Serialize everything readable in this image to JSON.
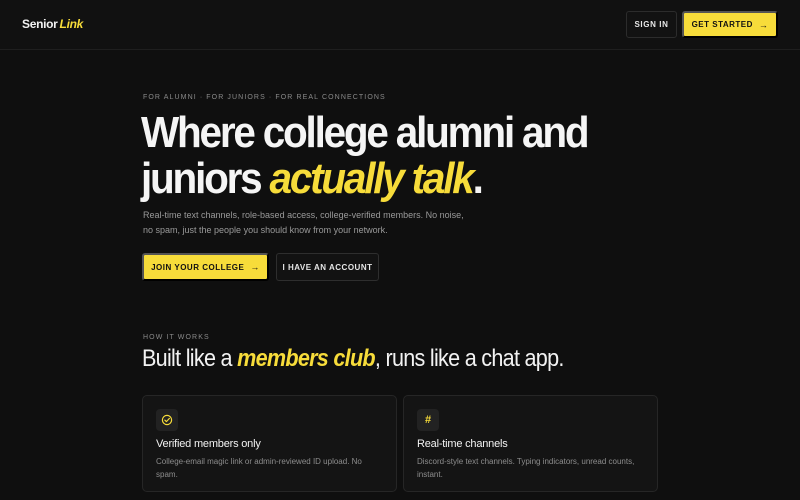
{
  "brand": {
    "name": "Senior",
    "accent": "Link"
  },
  "nav": {
    "sign_in": "SIGN IN",
    "get_started": "GET STARTED",
    "get_started_arrow": "→"
  },
  "hero": {
    "eyebrow": "FOR ALUMNI · FOR JUNIORS · FOR REAL CONNECTIONS",
    "title_line1": "Where college alumni and",
    "title_line2_prefix": "juniors ",
    "title_highlight": "actually talk",
    "title_suffix": ".",
    "subtitle": "Real-time text channels, role-based access, college-verified members. No noise, no spam, just the people you should know from your network.",
    "primary_cta": "JOIN YOUR COLLEGE",
    "primary_cta_arrow": "→",
    "secondary_cta": "I HAVE AN ACCOUNT"
  },
  "how": {
    "eyebrow": "HOW IT WORKS",
    "title_prefix": "Built like a ",
    "title_highlight": "members club",
    "title_suffix": ", runs like a chat app."
  },
  "cards": [
    {
      "icon": "check-circle-icon",
      "glyph": "✓",
      "title": "Verified members only",
      "desc": "College-email magic link or admin-reviewed ID upload. No spam."
    },
    {
      "icon": "hash-icon",
      "glyph": "#",
      "title": "Real-time channels",
      "desc": "Discord-style text channels. Typing indicators, unread counts, instant."
    }
  ],
  "colors": {
    "accent": "#f7dc3a",
    "background": "#0f0f0f",
    "card": "#141414"
  }
}
